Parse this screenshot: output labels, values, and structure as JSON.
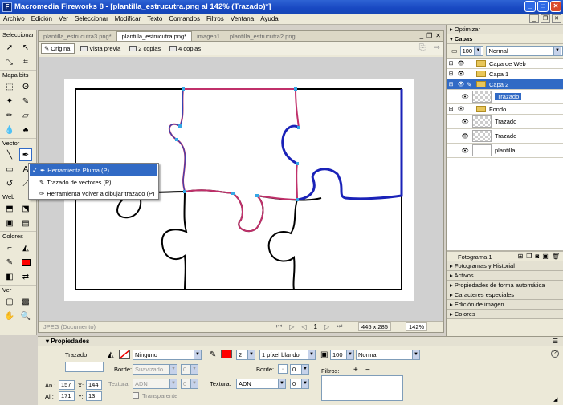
{
  "window": {
    "title": "Macromedia Fireworks 8 - [plantilla_estrucutra.png al 142% (Trazado)*]",
    "app_badge": "F"
  },
  "menu": [
    "Archivo",
    "Edición",
    "Ver",
    "Seleccionar",
    "Modificar",
    "Texto",
    "Comandos",
    "Filtros",
    "Ventana",
    "Ayuda"
  ],
  "tools": {
    "sections": [
      "Seleccionar",
      "Mapa bits",
      "Vector",
      "Web",
      "Colores",
      "Ver"
    ]
  },
  "document": {
    "tabs": [
      "plantilla_estrucutra3.png*",
      "plantilla_estrucutra.png*",
      "imagen1",
      "plantilla_estrucutra2.png"
    ],
    "active_tab_index": 1,
    "views": [
      "Original",
      "Vista previa",
      "2 copias",
      "4 copias"
    ],
    "status": {
      "format": "JPEG (Documento)",
      "frame": "1",
      "dimensions": "445 x 285",
      "zoom": "142%"
    }
  },
  "context_menu": {
    "items": [
      {
        "label": "Herramienta Pluma (P)",
        "checked": true,
        "highlighted": true
      },
      {
        "label": "Trazado de vectores (P)",
        "checked": false,
        "highlighted": false
      },
      {
        "label": "Herramienta Volver a dibujar trazado (P)",
        "checked": false,
        "highlighted": false
      }
    ]
  },
  "right_panel": {
    "optimize": "Optimizar",
    "layers_title": "Capas",
    "opacity": "100",
    "blend": "Normal",
    "layers": [
      {
        "label": "Capa de Web",
        "type": "layer"
      },
      {
        "label": "Capa 1",
        "type": "layer"
      },
      {
        "label": "Capa 2",
        "type": "layer",
        "highlighted": true
      },
      {
        "label": "Trazado",
        "type": "object",
        "highlighted": true
      },
      {
        "label": "Fondo",
        "type": "layer"
      },
      {
        "label": "Trazado",
        "type": "object"
      },
      {
        "label": "Trazado",
        "type": "object"
      },
      {
        "label": "plantilla",
        "type": "object"
      }
    ],
    "frame_label": "Fotograma 1",
    "collapsed_panels": [
      "Fotogramas y Historial",
      "Activos",
      "Propiedades de forma automática",
      "Caracteres especiales",
      "Edición de imagen",
      "Colores"
    ]
  },
  "properties": {
    "title": "Propiedades",
    "object_name": "Trazado",
    "w_label": "An.:",
    "w": "157",
    "h_label": "Al.:",
    "h": "171",
    "x_label": "X:",
    "x": "144",
    "y_label": "Y:",
    "y": "13",
    "fill": "Ninguno",
    "edge_label": "Borde:",
    "edge": "Suavizado",
    "edge_val": "0",
    "texture_label": "Textura:",
    "texture": "ADN",
    "texture_val": "0",
    "transparent_label": "Transparente",
    "stroke_size": "2",
    "stroke_type": "1 píxel blando",
    "stroke_edge_label": "Borde:",
    "stroke_edge_val": "0",
    "stroke_texture_label": "Textura:",
    "stroke_texture": "ADN",
    "stroke_texture_val": "0",
    "opacity": "100",
    "blend": "Normal",
    "filters_label": "Filtros:",
    "colors": {
      "stroke": "#ff0000"
    }
  }
}
